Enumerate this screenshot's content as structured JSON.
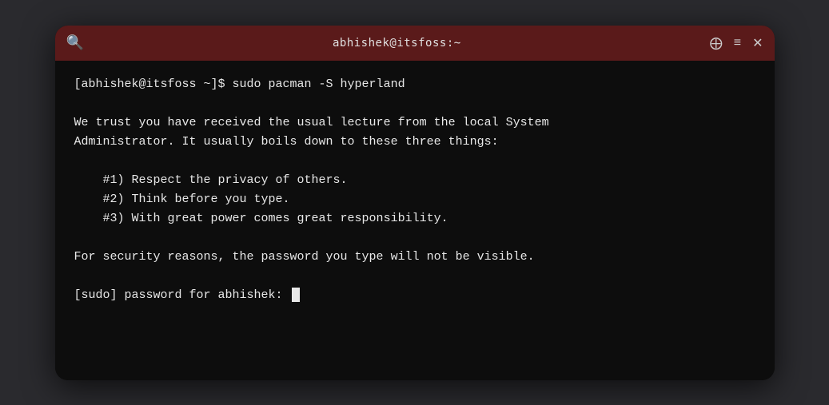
{
  "titlebar": {
    "title": "abhishek@itsfoss:~",
    "search_icon": "🔍",
    "new_tab_icon": "⊞",
    "menu_icon": "≡",
    "close_icon": "✕"
  },
  "terminal": {
    "lines": [
      "[abhishek@itsfoss ~]$ sudo pacman -S hyperland",
      "",
      "We trust you have received the usual lecture from the local System",
      "Administrator. It usually boils down to these three things:",
      "",
      "    #1) Respect the privacy of others.",
      "    #2) Think before you type.",
      "    #3) With great power comes great responsibility.",
      "",
      "For security reasons, the password you type will not be visible.",
      "",
      "[sudo] password for abhishek: "
    ]
  }
}
